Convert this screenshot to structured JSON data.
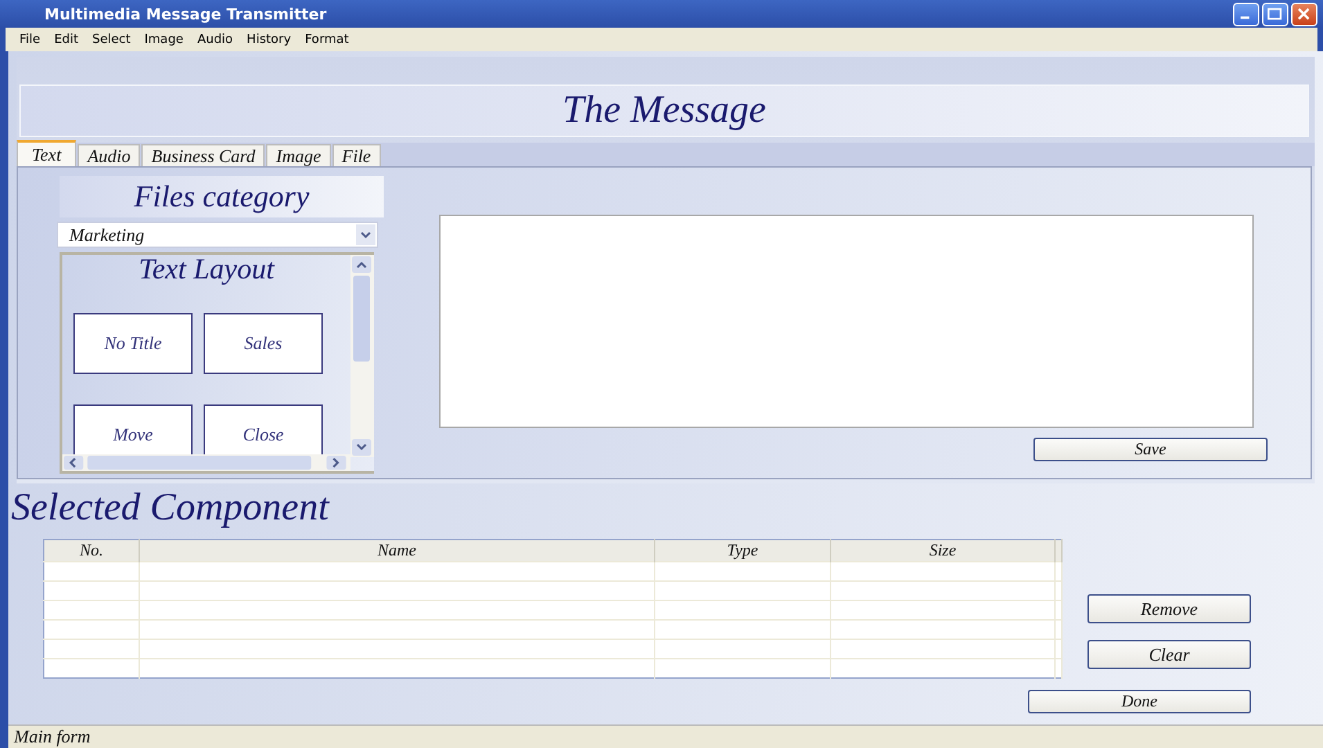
{
  "window": {
    "title": "Multimedia Message Transmitter"
  },
  "menu": [
    "File",
    "Edit",
    "Select",
    "Image",
    "Audio",
    "History",
    "Format"
  ],
  "header": {
    "title": "The Message"
  },
  "tabs": [
    {
      "label": "Text",
      "selected": true
    },
    {
      "label": "Audio",
      "selected": false
    },
    {
      "label": "Business Card",
      "selected": false
    },
    {
      "label": "Image",
      "selected": false
    },
    {
      "label": "File",
      "selected": false
    }
  ],
  "files_category": {
    "title": "Files category",
    "select": {
      "value": "Marketing"
    }
  },
  "text_layout": {
    "title": "Text Layout",
    "items": [
      "No Title",
      "Sales",
      "Move",
      "Close"
    ]
  },
  "save_button": "Save",
  "selected_component": {
    "title": "Selected Component",
    "table": {
      "columns": [
        "No.",
        "Name",
        "Type",
        "Size"
      ]
    },
    "buttons": [
      "Remove",
      "Clear"
    ],
    "done_button": "Done"
  },
  "status_bar": "Main form"
}
